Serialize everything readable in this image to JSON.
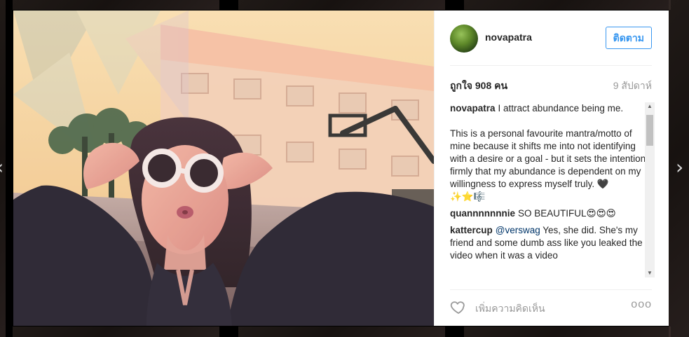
{
  "post": {
    "username": "novapatra",
    "follow_label": "ติดตาม",
    "likes_text": "ถูกใจ 908 คน",
    "time_text": "9 สัปดาห์",
    "add_comment_placeholder": "เพิ่มความคิดเห็น",
    "more_label": "ooo"
  },
  "comments": [
    {
      "user": "novapatra",
      "mention": "",
      "text": "I attract abundance being me.\n\nThis is a personal favourite mantra/motto of mine because it shifts me into not identifying with a desire or a goal - but it sets the intention firmly that my abundance is dependent on my willingness to express myself truly. 🖤\n✨⭐🎼"
    },
    {
      "user": "quannnnnnnie",
      "mention": "",
      "text": "SO BEAUTIFUL😍😍😍"
    },
    {
      "user": "kattercup",
      "mention": "@verswag",
      "text": " Yes, she did. She's my friend and some dumb ass like you leaked the video when it was a video"
    }
  ],
  "icons": {
    "nav_left": "chevron-left-icon",
    "nav_right": "chevron-right-icon",
    "heart": "heart-icon",
    "more": "more-icon"
  },
  "colors": {
    "accent": "#3897f0",
    "text": "#262626",
    "muted": "#999999"
  }
}
